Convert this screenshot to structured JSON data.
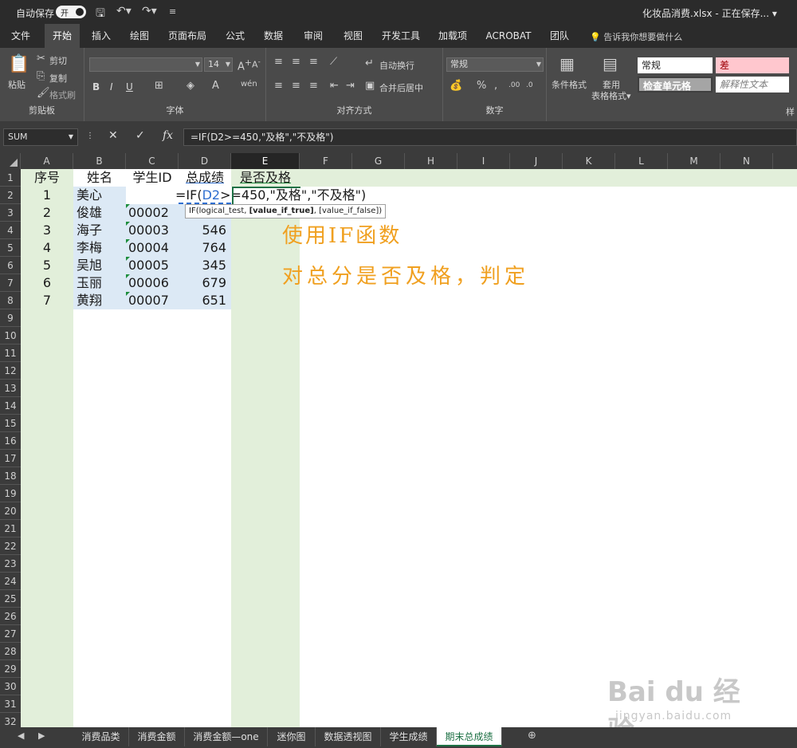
{
  "titlebar": {
    "autosave_label": "自动保存",
    "autosave_state": "开",
    "filename": "化妆品消费.xlsx - 正在保存... ▾"
  },
  "ribbon_tabs": [
    "文件",
    "开始",
    "插入",
    "绘图",
    "页面布局",
    "公式",
    "数据",
    "审阅",
    "视图",
    "开发工具",
    "加载项",
    "ACROBAT",
    "团队"
  ],
  "active_tab": "开始",
  "tell_me": "告诉我你想要做什么",
  "ribbon": {
    "clipboard": {
      "label": "剪贴板",
      "paste": "粘贴",
      "cut": "剪切",
      "copy": "复制",
      "format_painter": "格式刷"
    },
    "font": {
      "label": "字体",
      "size": "14",
      "bold": "B",
      "italic": "I",
      "underline": "U"
    },
    "alignment": {
      "label": "对齐方式",
      "wrap": "自动换行",
      "merge": "合并后居中"
    },
    "number": {
      "label": "数字",
      "format": "常规"
    },
    "styles": {
      "conditional": "条件格式",
      "table_format": "套用\n表格格式",
      "normal": "常规",
      "bad": "差",
      "check_cell": "检查单元格",
      "explanatory": "解释性文本",
      "label_partial": "样"
    }
  },
  "formula_bar": {
    "name_box": "SUM",
    "formula": "=IF(D2>=450,\"及格\",\"不及格\")"
  },
  "columns": [
    "A",
    "B",
    "C",
    "D",
    "E",
    "F",
    "G",
    "H",
    "I",
    "J",
    "K",
    "L",
    "M",
    "N"
  ],
  "selected_column": "E",
  "row_count": 32,
  "headers": {
    "a": "序号",
    "b": "姓名",
    "c": "学生ID",
    "d": "总成绩",
    "e": "是否及格"
  },
  "rows": [
    {
      "a": "1",
      "b": "美心",
      "c": "",
      "d": ""
    },
    {
      "a": "2",
      "b": "俊雄",
      "c": "00002",
      "d": ""
    },
    {
      "a": "3",
      "b": "海子",
      "c": "00003",
      "d": "546"
    },
    {
      "a": "4",
      "b": "李梅",
      "c": "00004",
      "d": "764"
    },
    {
      "a": "5",
      "b": "吴旭",
      "c": "00005",
      "d": "345"
    },
    {
      "a": "6",
      "b": "玉丽",
      "c": "00006",
      "d": "679"
    },
    {
      "a": "7",
      "b": "黄翔",
      "c": "00007",
      "d": "651"
    }
  ],
  "editing_cell": {
    "prefix": "=IF(",
    "ref": "D2",
    "rest": ">=450,\"及格\",\"不及格\")"
  },
  "tooltip": {
    "pre": "IF(logical_test, ",
    "bold": "[value_if_true]",
    "post": ", [value_if_false])"
  },
  "annotation": {
    "line1": "使用IF函数",
    "line2": "对总分是否及格，判定"
  },
  "watermark": {
    "brand": "Bai du 经验",
    "url": "jingyan.baidu.com"
  },
  "sheet_tabs": [
    "消费品类",
    "消费金额",
    "消费金额—one",
    "迷你图",
    "数据透视图",
    "学生成绩",
    "期末总成绩"
  ],
  "active_sheet": "期末总成绩",
  "colors": {
    "accent": "#1e7145",
    "annotation": "#f0a020",
    "highlight": "#dce9f5",
    "sheet_bg": "#e2efda"
  }
}
